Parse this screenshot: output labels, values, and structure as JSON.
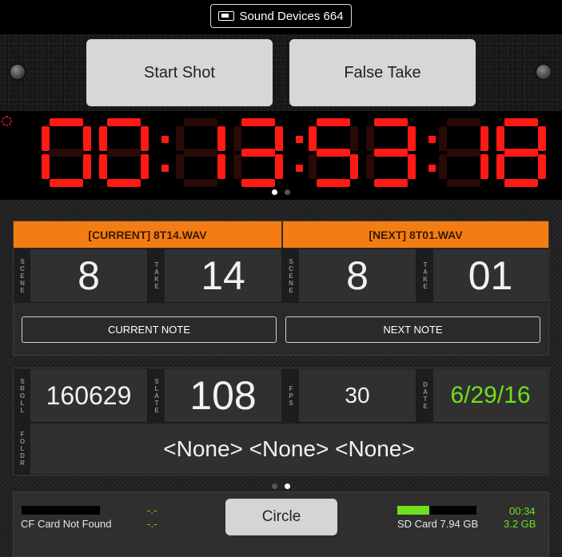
{
  "header": {
    "device_label": "Sound Devices 664",
    "device_icon": "battery-icon"
  },
  "controls": {
    "start_shot": "Start Shot",
    "false_take": "False Take"
  },
  "timecode": {
    "hours": "00",
    "minutes": "13",
    "seconds": "53",
    "frames": "18",
    "color": "#ff1a14",
    "page": 1,
    "pages": 2
  },
  "current": {
    "header": "[CURRENT] 8T14.WAV",
    "scene_label": "SCENE",
    "scene": "8",
    "take_label": "TAKE",
    "take": "14",
    "note_button": "CURRENT NOTE"
  },
  "next": {
    "header": "[NEXT] 8T01.WAV",
    "scene_label": "SCENE",
    "scene": "8",
    "take_label": "TAKE",
    "take": "01",
    "note_button": "NEXT NOTE"
  },
  "metadata": {
    "sroll_label": "SROLL",
    "sroll": "160629",
    "slate_label": "SLATE",
    "slate": "108",
    "fps_label": "FPS",
    "fps": "30",
    "date_label": "DATE",
    "date": "6/29/16",
    "foldr_label": "FOLDR",
    "foldr": "<None> <None> <None>"
  },
  "pager": {
    "page": 2,
    "pages": 2
  },
  "footer": {
    "cf_status": "CF Card Not Found",
    "cf_time": "-.-",
    "cf_size": "-.-",
    "circle_button": "Circle",
    "sd_label": "SD Card 7.94 GB",
    "sd_fill": 0.4,
    "sd_time": "00:34",
    "sd_size": "3.2 GB"
  },
  "colors": {
    "accent_orange": "#f47d13",
    "status_green": "#6ee01e",
    "timecode_red": "#ff1a14"
  }
}
